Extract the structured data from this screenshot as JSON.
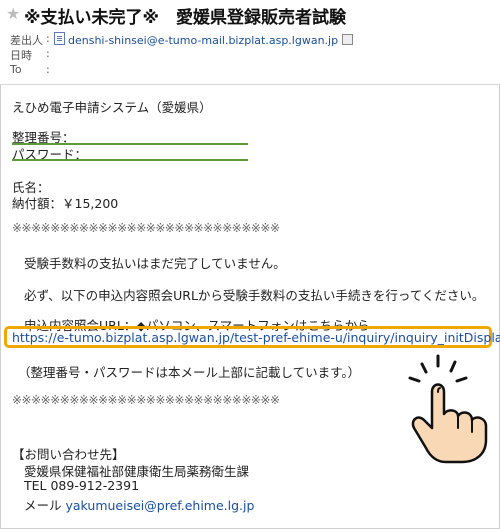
{
  "header": {
    "subject": "※支払い未完了※　愛媛県登録販売者試験",
    "from_label": "差出人",
    "from_address": "denshi-shinsei@e-tumo-mail.bizplat.asp.lgwan.jp",
    "date_label": "日時",
    "to_label": "To",
    "colon": ":"
  },
  "body": {
    "system_name": "えひめ電子申請システム（愛媛県）",
    "reg_number_label": "整理番号：",
    "password_label": "パスワード：",
    "name_label": "氏名：",
    "amount_label": "納付額：",
    "amount_value": "￥15,200",
    "separator": "※※※※※※※※※※※※※※※※※※※※※※※※※※※※",
    "notice1": "受験手数料の支払いはまだ完了していません。",
    "notice2": "必ず、以下の申込内容照会URLから受験手数料の支払い手続きを行ってください。",
    "inquiry_label": "申込内容照会URL：◆パソコン、スマートフォンはこちらから",
    "inquiry_url": "https://e-tumo.bizplat.asp.lgwan.jp/test-pref-ehime-u/inquiry/inquiry_initDisplay",
    "note": "（整理番号・パスワードは本メール上部に記載しています。）",
    "contact_heading": "【お問い合わせ先】",
    "contact_dept": "愛媛県保健福祉部健康衛生局薬務衛生課",
    "contact_tel": "TEL 089-912-2391",
    "contact_mail_label": "メール",
    "contact_mail": "yakumueisei@pref.ehime.lg.jp"
  },
  "colors": {
    "highlight_border": "#f0a800",
    "underline": "#5a9e3a",
    "link": "#1a4fa0"
  },
  "icons": [
    "star-icon",
    "document-icon",
    "contact-card-icon",
    "pointing-hand-icon"
  ]
}
